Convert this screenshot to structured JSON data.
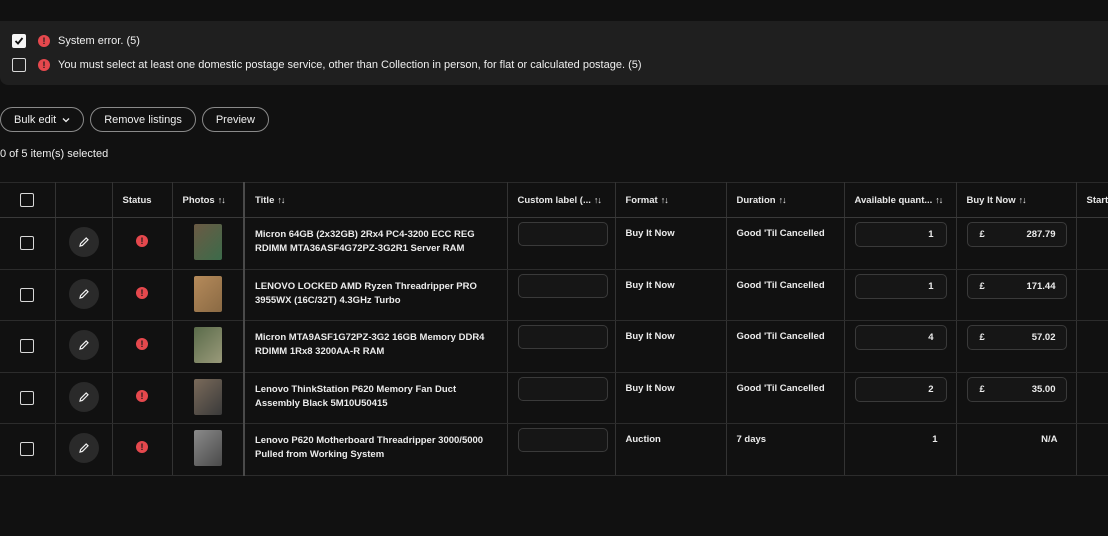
{
  "errors": [
    {
      "checked": true,
      "text": "System error. (5)"
    },
    {
      "checked": false,
      "text": "You must select at least one domestic postage service, other than Collection in person, for flat or calculated postage. (5)"
    }
  ],
  "toolbar": {
    "bulk_edit": "Bulk edit",
    "remove": "Remove listings",
    "preview": "Preview"
  },
  "selection_text": "0 of 5 item(s) selected",
  "table": {
    "headers": {
      "status": "Status",
      "photos": "Photos",
      "title": "Title",
      "custom_label": "Custom label (...",
      "format": "Format",
      "duration": "Duration",
      "available_qty": "Available quant...",
      "buy_it_now": "Buy It Now",
      "start": "Start"
    },
    "sort_glyph": "↑↓",
    "rows": [
      {
        "title": "Micron 64GB (2x32GB) 2Rx4 PC4-3200 ECC REG RDIMM MTA36ASF4G72PZ-3G2R1 Server RAM",
        "format": "Buy It Now",
        "duration": "Good 'Til Cancelled",
        "qty": "1",
        "currency": "£",
        "price": "287.79"
      },
      {
        "title": "LENOVO LOCKED AMD Ryzen Threadripper PRO 3955WX (16C/32T) 4.3GHz Turbo",
        "format": "Buy It Now",
        "duration": "Good 'Til Cancelled",
        "qty": "1",
        "currency": "£",
        "price": "171.44"
      },
      {
        "title": "Micron MTA9ASF1G72PZ-3G2 16GB Memory DDR4 RDIMM 1Rx8 3200AA-R RAM",
        "format": "Buy It Now",
        "duration": "Good 'Til Cancelled",
        "qty": "4",
        "currency": "£",
        "price": "57.02"
      },
      {
        "title": "Lenovo ThinkStation P620 Memory Fan Duct Assembly Black 5M10U50415",
        "format": "Buy It Now",
        "duration": "Good 'Til Cancelled",
        "qty": "2",
        "currency": "£",
        "price": "35.00"
      },
      {
        "title": "Lenovo P620 Motherboard Threadripper 3000/5000 Pulled from Working System",
        "format": "Auction",
        "duration": "7 days",
        "qty": "1",
        "price_na": "N/A"
      }
    ]
  },
  "colors": {
    "error_red": "#e5484d",
    "background": "#111111",
    "banner": "#1f1f1f"
  }
}
